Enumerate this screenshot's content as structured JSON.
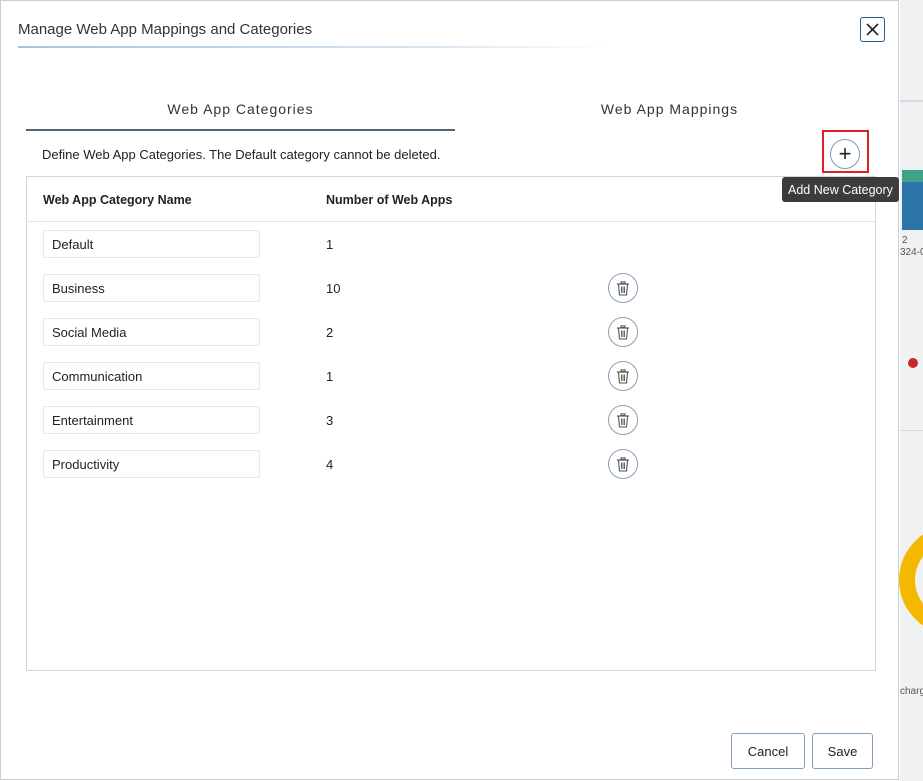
{
  "background": {
    "fragments": [
      "2",
      "324-0",
      "charg"
    ]
  },
  "dialog": {
    "title": "Manage Web App Mappings and Categories",
    "close_icon": "close-icon"
  },
  "tabs": [
    {
      "label": "Web App Categories",
      "active": true
    },
    {
      "label": "Web App Mappings",
      "active": false
    }
  ],
  "description": "Define Web App Categories. The Default category cannot be deleted.",
  "add_button": {
    "symbol": "+",
    "icon": "plus-icon"
  },
  "tooltip": "Add New Category",
  "table": {
    "columns": [
      "Web App Category Name",
      "Number of Web Apps"
    ],
    "rows": [
      {
        "name": "Default",
        "count": "1",
        "deletable": false
      },
      {
        "name": "Business",
        "count": "10",
        "deletable": true
      },
      {
        "name": "Social Media",
        "count": "2",
        "deletable": true
      },
      {
        "name": "Communication",
        "count": "1",
        "deletable": true
      },
      {
        "name": "Entertainment",
        "count": "3",
        "deletable": true
      },
      {
        "name": "Productivity",
        "count": "4",
        "deletable": true
      }
    ]
  },
  "footer": {
    "cancel_label": "Cancel",
    "save_label": "Save"
  },
  "colors": {
    "accent_border": "#7f9fbd",
    "highlight_red": "#e02020",
    "tooltip_bg": "#3c3c3c"
  }
}
